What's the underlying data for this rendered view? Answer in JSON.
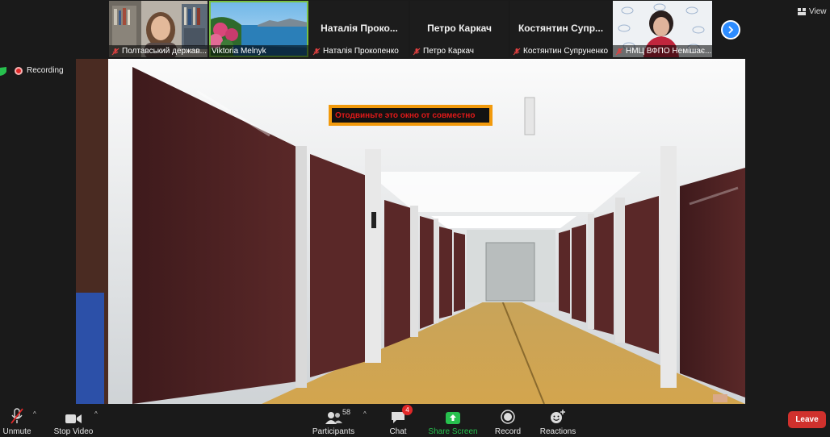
{
  "participants": [
    {
      "name": "Полтавський держав...",
      "muted": true
    },
    {
      "name": "Viktoria Melnyk",
      "muted": false,
      "active": true
    },
    {
      "display": "Наталія  Проко...",
      "name": "Наталія Прокопенко",
      "muted": true
    },
    {
      "display": "Петро Каркач",
      "name": "Петро Каркач",
      "muted": true
    },
    {
      "display": "Костянтин  Супр...",
      "name": "Костянтин Супруненко",
      "muted": true
    },
    {
      "name": "НМЦ ВФПО Немішає...",
      "muted": true
    }
  ],
  "view_label": "View",
  "recording_label": "Recording",
  "overlay_text": "Отодвиньте это окно от совместно",
  "toolbar": {
    "unmute": "Unmute",
    "stop_video": "Stop Video",
    "participants": "Participants",
    "participants_count": "58",
    "chat": "Chat",
    "chat_badge": "4",
    "share_screen": "Share Screen",
    "record": "Record",
    "reactions": "Reactions",
    "leave": "Leave"
  },
  "colors": {
    "background": "#1a1a1a",
    "accent_blue": "#2d8cff",
    "share_green": "#27c04e",
    "leave_red": "#d0312d",
    "overlay_border": "#f29a0c",
    "overlay_text": "#e01919",
    "active_tile": "#7ac142"
  }
}
